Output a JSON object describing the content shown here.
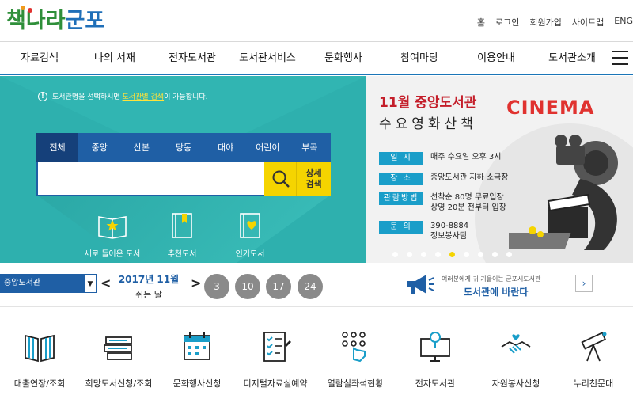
{
  "header": {
    "logo_chars": [
      "책",
      "나",
      "라",
      "군",
      "포"
    ],
    "util_links": [
      "홈",
      "로그인",
      "회원가입",
      "사이트맵",
      "ENG"
    ]
  },
  "nav": {
    "items": [
      "자료검색",
      "나의 서재",
      "전자도서관",
      "도서관서비스",
      "문화행사",
      "참여마당",
      "이용안내",
      "도서관소개"
    ]
  },
  "search": {
    "notice_pre": "도서관명을 선택하시면 ",
    "notice_hl": "도서관별 검색",
    "notice_post": "이 가능합니다.",
    "tabs": [
      "전체",
      "중앙",
      "산본",
      "당동",
      "대야",
      "어린이",
      "부곡"
    ],
    "input_value": "",
    "advanced_line1": "상세",
    "advanced_line2": "검색"
  },
  "quick_links": [
    "새로 들어온 도서",
    "추천도서",
    "인기도서"
  ],
  "banner": {
    "month": "11월",
    "library": "중앙도서관",
    "subtitle": "수요영화산책",
    "cinema": "CINEMA",
    "rows": [
      {
        "label": "일 시",
        "value": "매주 수요일 오후 3시",
        "value2": ""
      },
      {
        "label": "장 소",
        "value": "중앙도서관 지하 소극장",
        "value2": ""
      },
      {
        "label": "관람방법",
        "value": "선착순 80명 무료입장",
        "value2": "상영 20분 전부터 입장"
      },
      {
        "label": "문 의",
        "value": "390-8884",
        "value2": "정보봉사팀"
      }
    ],
    "active_dot": 4,
    "dot_count": 9
  },
  "closed_days": {
    "library_select": "중앙도서관",
    "prev": "<",
    "next": ">",
    "month": "2017년 11월",
    "label": "쉬는 날",
    "days": [
      "3",
      "10",
      "17",
      "24"
    ]
  },
  "voice": {
    "line1": "여러분에게 귀 기울이는 군포시도서관",
    "line2": "도서관에 바란다"
  },
  "services": [
    "대출연장/조회",
    "희망도서신청/조회",
    "문화행사신청",
    "디지털자료실예약",
    "열람실좌석현황",
    "전자도서관",
    "자원봉사신청",
    "누리천문대"
  ],
  "colors": {
    "teal": "#2eb0ae",
    "navy": "#1f5fa5",
    "yellow": "#f5d400",
    "banner_label": "#1a9ec9",
    "red": "#c41e2a"
  }
}
